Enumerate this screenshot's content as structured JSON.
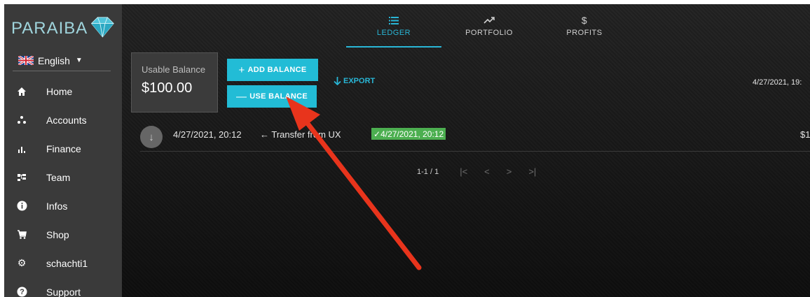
{
  "brand": {
    "name": "PARAIBA",
    "logo_icon": "diamond-gem"
  },
  "language": {
    "label": "English",
    "flag_icon": "uk-flag"
  },
  "sidebar": {
    "items": [
      {
        "label": "Home",
        "icon": "home-icon"
      },
      {
        "label": "Accounts",
        "icon": "accounts-icon"
      },
      {
        "label": "Finance",
        "icon": "finance-icon"
      },
      {
        "label": "Team",
        "icon": "team-icon"
      },
      {
        "label": "Infos",
        "icon": "info-icon"
      },
      {
        "label": "Shop",
        "icon": "cart-icon"
      },
      {
        "label": "schachti1",
        "icon": "gear-icon"
      },
      {
        "label": "Support",
        "icon": "help-icon"
      }
    ]
  },
  "tabs": [
    {
      "label": "LEDGER",
      "icon": "list-icon",
      "active": true
    },
    {
      "label": "PORTFOLIO",
      "icon": "trending-up-icon",
      "active": false
    },
    {
      "label": "PROFITS",
      "icon": "dollar-icon",
      "active": false
    }
  ],
  "balance": {
    "label": "Usable Balance",
    "value": "$100.00"
  },
  "actions": {
    "add_balance": "ADD BALANCE",
    "use_balance": "USE BALANCE",
    "export": "EXPORT"
  },
  "top_date": "4/27/2021, 19:",
  "ledger_entry": {
    "date": "4/27/2021, 20:12",
    "description": "Transfer from UX",
    "badge": "4/27/2021, 20:12",
    "amount": "$1"
  },
  "pagination": {
    "range": "1-1 / 1"
  },
  "colors": {
    "accent": "#22bcd6",
    "success": "#4caf50",
    "sidebar_bg": "#3a3a3a",
    "annotation_arrow": "#e8341c"
  }
}
